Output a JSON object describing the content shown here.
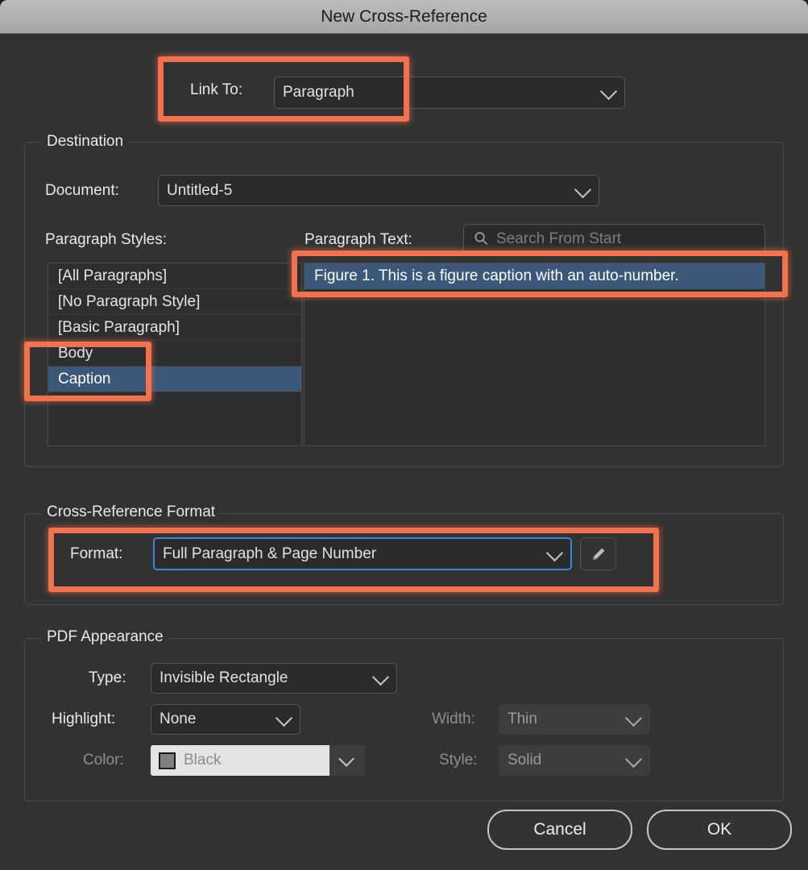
{
  "window": {
    "title": "New Cross-Reference"
  },
  "link_to": {
    "label": "Link To:",
    "value": "Paragraph"
  },
  "destination": {
    "group_title": "Destination",
    "document_label": "Document:",
    "document_value": "Untitled-5",
    "paragraph_styles_label": "Paragraph Styles:",
    "paragraph_text_label": "Paragraph Text:",
    "search_placeholder": "Search From Start",
    "search_icon": "search-icon",
    "styles": [
      {
        "label": "[All Paragraphs]",
        "selected": false
      },
      {
        "label": "[No Paragraph Style]",
        "selected": false
      },
      {
        "label": "[Basic Paragraph]",
        "selected": false
      },
      {
        "label": "Body",
        "selected": false
      },
      {
        "label": "Caption",
        "selected": true
      }
    ],
    "paragraphs": [
      {
        "label": "Figure 1.   This is a figure caption with an auto-number.",
        "selected": true
      }
    ]
  },
  "cross_reference_format": {
    "group_title": "Cross-Reference Format",
    "format_label": "Format:",
    "format_value": "Full Paragraph & Page Number",
    "edit_icon": "pencil-icon"
  },
  "pdf_appearance": {
    "group_title": "PDF Appearance",
    "type_label": "Type:",
    "type_value": "Invisible Rectangle",
    "highlight_label": "Highlight:",
    "highlight_value": "None",
    "color_label": "Color:",
    "color_value": "Black",
    "color_swatch": "#808080",
    "width_label": "Width:",
    "width_value": "Thin",
    "style_label": "Style:",
    "style_value": "Solid"
  },
  "footer": {
    "cancel_label": "Cancel",
    "ok_label": "OK"
  },
  "annotations": {
    "accent_color": "#f4714d",
    "highlight_color": "#3a5878",
    "focus_color": "#3b87d6"
  }
}
